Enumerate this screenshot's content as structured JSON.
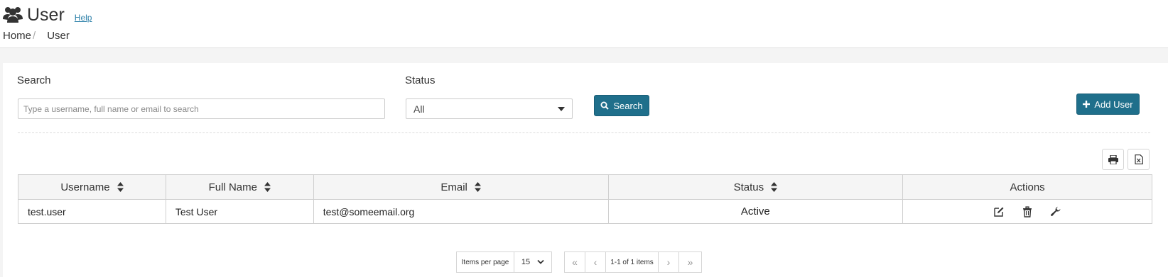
{
  "header": {
    "title": "User",
    "help_label": "Help",
    "title_icon": "users-icon",
    "breadcrumb": [
      "Home",
      "User"
    ],
    "breadcrumb_separator": "/"
  },
  "filters": {
    "search_label": "Search",
    "search_placeholder": "Type a username, full name or email to search",
    "search_value": "",
    "status_label": "Status",
    "status_value": "All",
    "search_button": "Search",
    "add_user_button": "Add User"
  },
  "toolbar": {
    "print_icon": "print-icon",
    "excel_icon": "excel-export-icon"
  },
  "table": {
    "columns": [
      {
        "label": "Username",
        "sortable": true
      },
      {
        "label": "Full Name",
        "sortable": true
      },
      {
        "label": "Email",
        "sortable": true
      },
      {
        "label": "Status",
        "sortable": true
      },
      {
        "label": "Actions",
        "sortable": false
      }
    ],
    "rows": [
      {
        "username": "test.user",
        "full_name": "Test User",
        "email": "test@someemail.org",
        "status": "Active",
        "actions": [
          "edit-icon",
          "delete-icon",
          "settings-wrench-icon"
        ]
      }
    ]
  },
  "pager": {
    "items_per_page_label": "Items per page",
    "page_size": "15",
    "first_label": "«",
    "prev_label": "‹",
    "info": "1-1 of 1 items",
    "next_label": "›",
    "last_label": "»"
  },
  "colors": {
    "primary": "#1f6f8b",
    "link": "#2a7fa8",
    "header_bg": "#f5f5f5",
    "page_bg": "#f4f4f4"
  }
}
